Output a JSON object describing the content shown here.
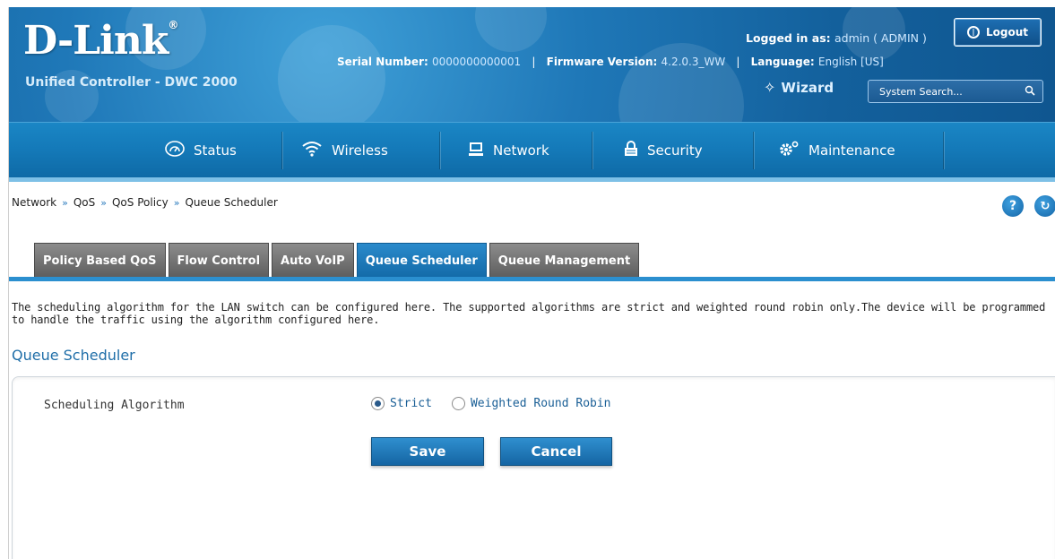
{
  "header": {
    "brand": "D-Link",
    "brand_mark": "®",
    "product": "Unified Controller - DWC 2000",
    "logged_in_label": "Logged in as:",
    "logged_in_value": "admin ( ADMIN )",
    "logout_label": "Logout",
    "serial_label": "Serial Number:",
    "serial_value": "0000000000001",
    "firmware_label": "Firmware Version:",
    "firmware_value": "4.2.0.3_WW",
    "language_label": "Language:",
    "language_value": "English [US]",
    "separator": "|",
    "wizard_label": "Wizard",
    "search_placeholder": "System Search..."
  },
  "nav": {
    "items": [
      {
        "label": "Status",
        "icon": "status-icon"
      },
      {
        "label": "Wireless",
        "icon": "wifi-icon"
      },
      {
        "label": "Network",
        "icon": "network-icon"
      },
      {
        "label": "Security",
        "icon": "lock-icon"
      },
      {
        "label": "Maintenance",
        "icon": "gear-icon"
      }
    ]
  },
  "breadcrumb": {
    "items": [
      "Network",
      "QoS",
      "QoS Policy",
      "Queue Scheduler"
    ],
    "separator": "»"
  },
  "tabs": [
    {
      "label": "Policy Based QoS",
      "active": false
    },
    {
      "label": "Flow Control",
      "active": false
    },
    {
      "label": "Auto VoIP",
      "active": false
    },
    {
      "label": "Queue Scheduler",
      "active": true
    },
    {
      "label": "Queue Management",
      "active": false
    }
  ],
  "description": "The scheduling algorithm for the LAN switch can be configured here. The supported algorithms are strict and weighted round robin only.The device will be programmed to handle the traffic using the algorithm configured here.",
  "section_title": "Queue Scheduler",
  "form": {
    "field_label": "Scheduling Algorithm",
    "options": [
      {
        "label": "Strict",
        "selected": true
      },
      {
        "label": "Weighted Round Robin",
        "selected": false
      }
    ],
    "save_label": "Save",
    "cancel_label": "Cancel"
  },
  "colors": {
    "accent": "#1479b8",
    "tab_active": "#2a8acb",
    "tab_inactive": "#6e6e6e",
    "title_blue": "#1f6ea8"
  }
}
